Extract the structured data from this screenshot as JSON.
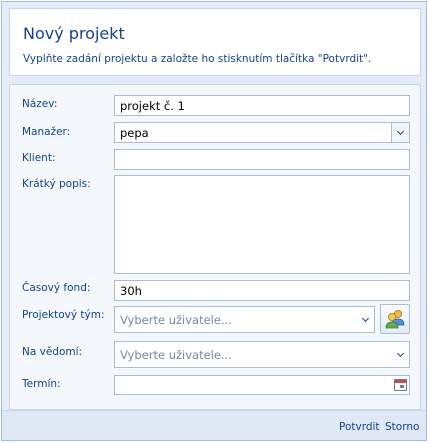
{
  "header": {
    "title": "Nový projekt",
    "subtitle": "Vyplňte zadání projektu a založte ho stisknutím tlačítka \"Potvrdit\"."
  },
  "form": {
    "name_label": "Název:",
    "name_value": "projekt č. 1",
    "manager_label": "Manažer:",
    "manager_value": "pepa",
    "client_label": "Klient:",
    "client_value": "",
    "description_label": "Krátký popis:",
    "description_value": "",
    "time_fund_label": "Časový fond:",
    "time_fund_value": "30h",
    "team_label": "Projektový tým:",
    "team_placeholder": "Vyberte uživatele...",
    "notify_label": "Na vědomí:",
    "notify_placeholder": "Vyberte uživatele...",
    "deadline_label": "Termín:",
    "deadline_value": ""
  },
  "footer": {
    "confirm_label": "Potvrdit",
    "cancel_label": "Storno"
  },
  "icons": {
    "users": "users-group-icon",
    "calendar": "calendar-icon",
    "dropdown": "chevron-down-icon"
  },
  "colors": {
    "accent_text": "#15428b",
    "panel_border": "#a3bde0",
    "dialog_bg": "#e3ecf7"
  }
}
